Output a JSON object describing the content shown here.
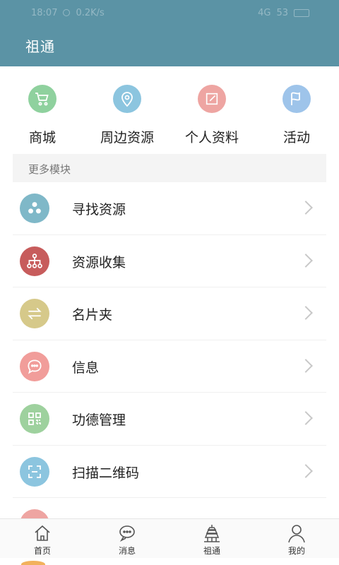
{
  "header": {
    "title": "祖通",
    "color": "#5b93a5"
  },
  "status_bar": {
    "time": "18:07",
    "speed": "0.2K/s",
    "network": "4G",
    "battery": "53"
  },
  "quick_actions": [
    {
      "label": "商城",
      "icon": "shopping-cart-icon",
      "color": "#8fd19e"
    },
    {
      "label": "周边资源",
      "icon": "location-pin-icon",
      "color": "#8cc5df"
    },
    {
      "label": "个人资料",
      "icon": "edit-icon",
      "color": "#eea5a2"
    },
    {
      "label": "活动",
      "icon": "flag-icon",
      "color": "#9ec4ea"
    }
  ],
  "section": {
    "label": "更多模块"
  },
  "menu": [
    {
      "label": "寻找资源",
      "icon": "share-cluster-icon",
      "color": "#7fb8c8"
    },
    {
      "label": "资源收集",
      "icon": "hierarchy-icon",
      "color": "#c75c5c"
    },
    {
      "label": "名片夹",
      "icon": "swap-arrows-icon",
      "color": "#d6c98a"
    },
    {
      "label": "信息",
      "icon": "chat-bubble-icon",
      "color": "#f19d9a"
    },
    {
      "label": "功德管理",
      "icon": "grid-qr-icon",
      "color": "#9ed19e"
    },
    {
      "label": "扫描二维码",
      "icon": "scan-icon",
      "color": "#8cc5df"
    }
  ],
  "tabbar": [
    {
      "label": "首页",
      "icon": "home-icon"
    },
    {
      "label": "消息",
      "icon": "message-icon"
    },
    {
      "label": "祖通",
      "icon": "pagoda-icon"
    },
    {
      "label": "我的",
      "icon": "user-icon"
    }
  ]
}
